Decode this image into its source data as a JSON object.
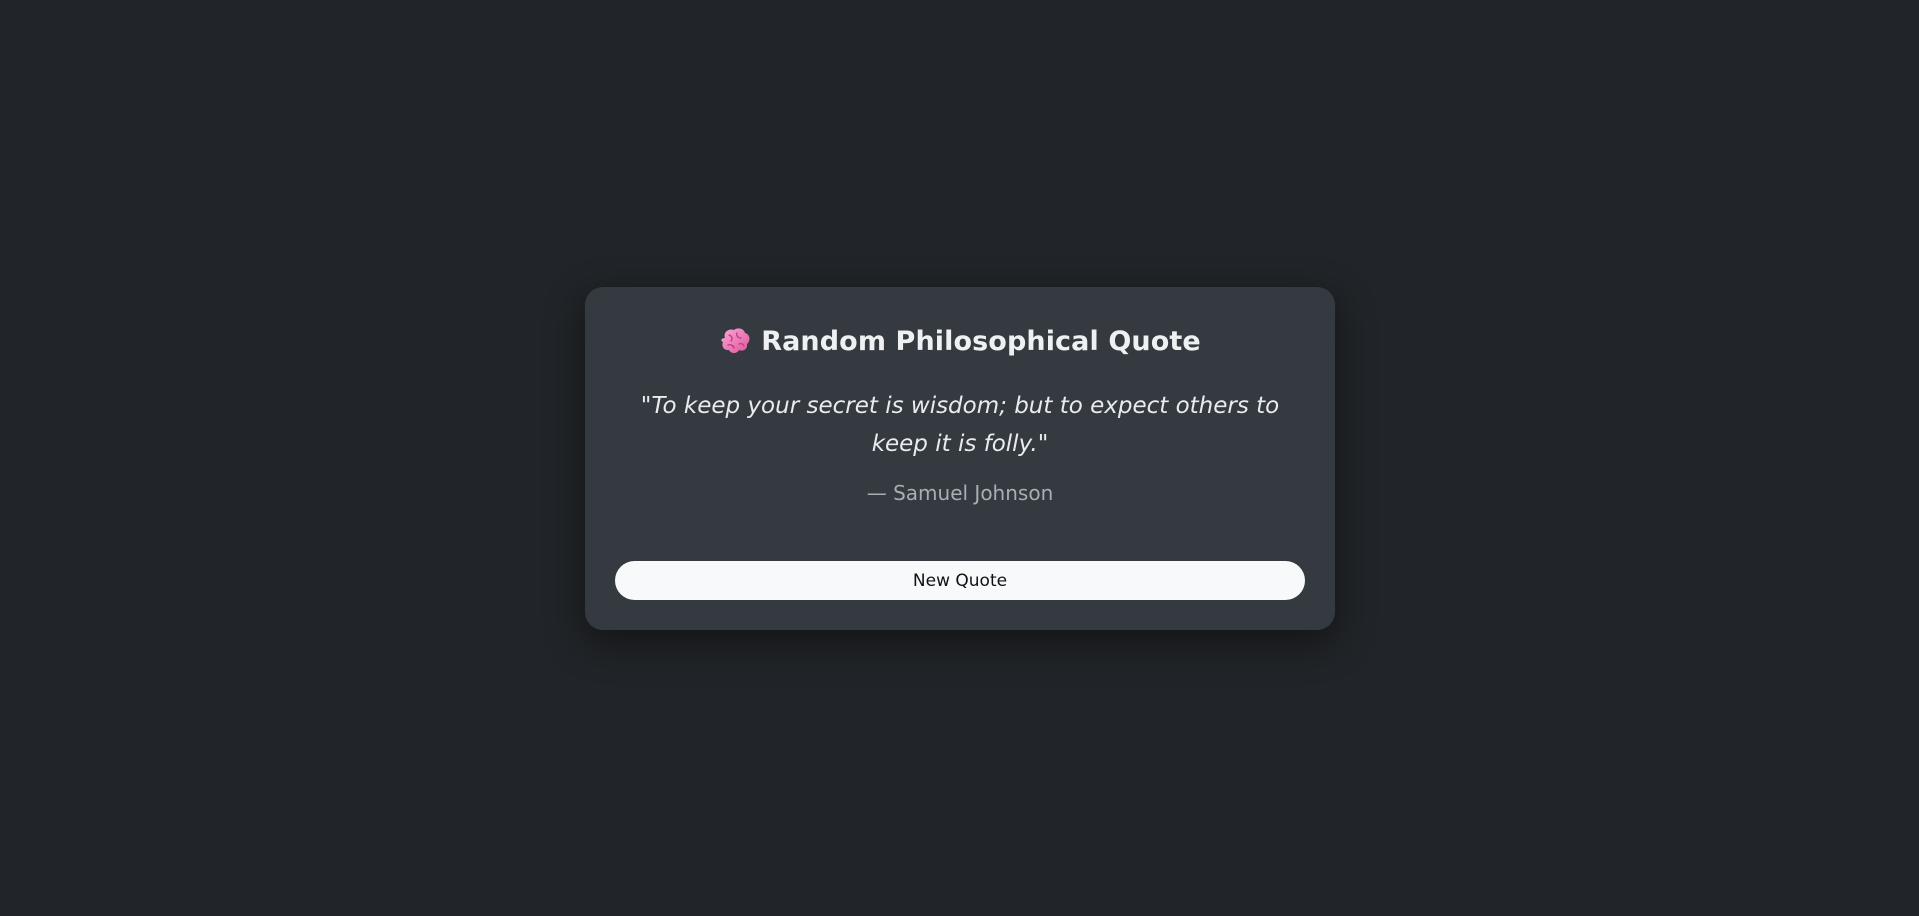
{
  "header": {
    "icon": "brain-icon",
    "title": "Random Philosophical Quote"
  },
  "quote": {
    "text": "\"To keep your secret is wisdom; but to expect others to keep it is folly.\"",
    "author": "— Samuel Johnson"
  },
  "actions": {
    "new_quote_label": "New Quote"
  },
  "colors": {
    "background": "#212428",
    "card": "#343a40",
    "button": "#f8f9fa",
    "icon_pink": "#f472b6"
  }
}
